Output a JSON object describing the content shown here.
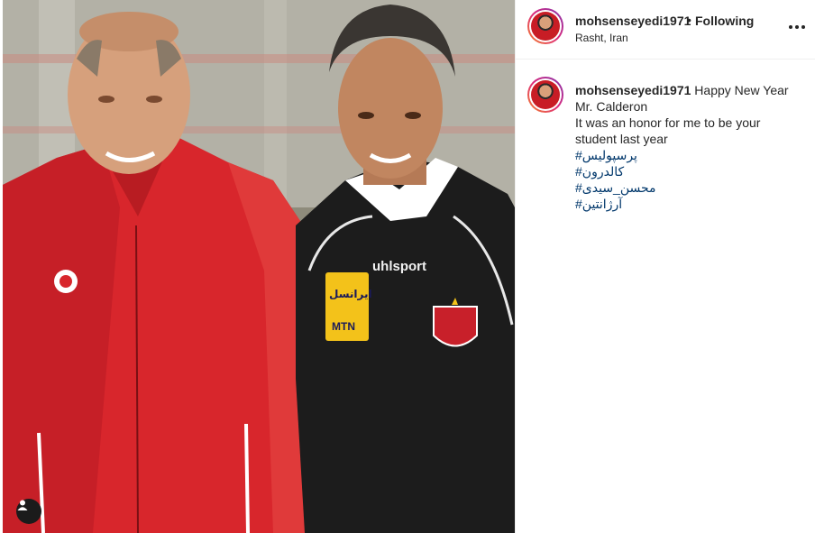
{
  "post": {
    "username": "mohsenseyedi1971",
    "separator": "•",
    "follow_status": "Following",
    "location": "Rasht, Iran",
    "more_icon": "more-horizontal-icon",
    "tag_icon": "user-tag-icon"
  },
  "photo": {
    "jacket_brand": "uhlsport",
    "sponsor_top": "ایرانسل",
    "sponsor_bottom": "MTN"
  },
  "caption": {
    "username": "mohsenseyedi1971",
    "first_line": "Happy New Year",
    "line2": "Mr. Calderon",
    "line3": "It was an honor for me to be your",
    "line4": "student last year",
    "hashtags": [
      "#پرسپولیس",
      "#کالدرون",
      "#محسن_سیدی",
      "#آرژانتین"
    ]
  },
  "colors": {
    "link": "#00376b",
    "text": "#262626",
    "story_ring": "#dd2a7b"
  }
}
